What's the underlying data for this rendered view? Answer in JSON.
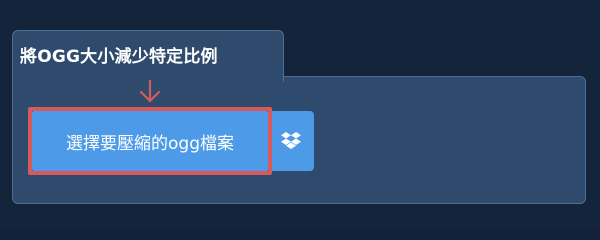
{
  "tab": {
    "title": "將OGG大小減少特定比例"
  },
  "upload": {
    "button_label": "選擇要壓縮的ogg檔案",
    "dropbox_icon": "dropbox-icon",
    "arrow_icon": "arrow-down-icon"
  },
  "colors": {
    "page_bg": "#14243b",
    "panel_bg": "#2e4b6d",
    "panel_border": "#4f6d90",
    "button_bg": "#4d9be8",
    "highlight": "#d65a5a",
    "text": "#ffffff"
  }
}
